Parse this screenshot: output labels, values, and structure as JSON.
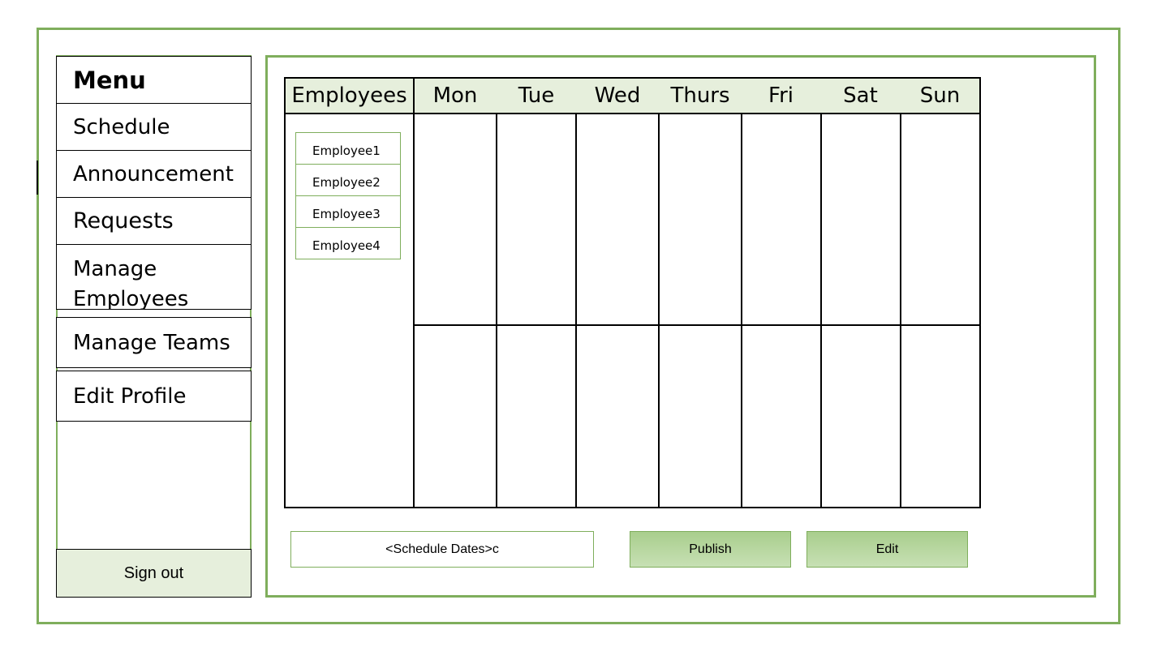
{
  "sidebar": {
    "title": "Menu",
    "items": [
      {
        "label": "Schedule"
      },
      {
        "label": "Announcement"
      },
      {
        "label": "Requests"
      },
      {
        "label": "Manage Employees"
      },
      {
        "label": "Manage Teams"
      },
      {
        "label": "Edit Profile"
      }
    ],
    "signout_label": "Sign out"
  },
  "schedule": {
    "employees_header": "Employees",
    "days": [
      "Mon",
      "Tue",
      "Wed",
      "Thurs",
      "Fri",
      "Sat",
      "Sun"
    ],
    "employees": [
      "Employee1",
      "Employee2",
      "Employee3",
      "Employee4"
    ]
  },
  "controls": {
    "dates_value": "<Schedule Dates>c",
    "publish_label": "Publish",
    "edit_label": "Edit"
  },
  "colors": {
    "frame_border": "#7fae5c",
    "header_fill": "#e6efdc",
    "button_fill": "#b5d59c"
  }
}
